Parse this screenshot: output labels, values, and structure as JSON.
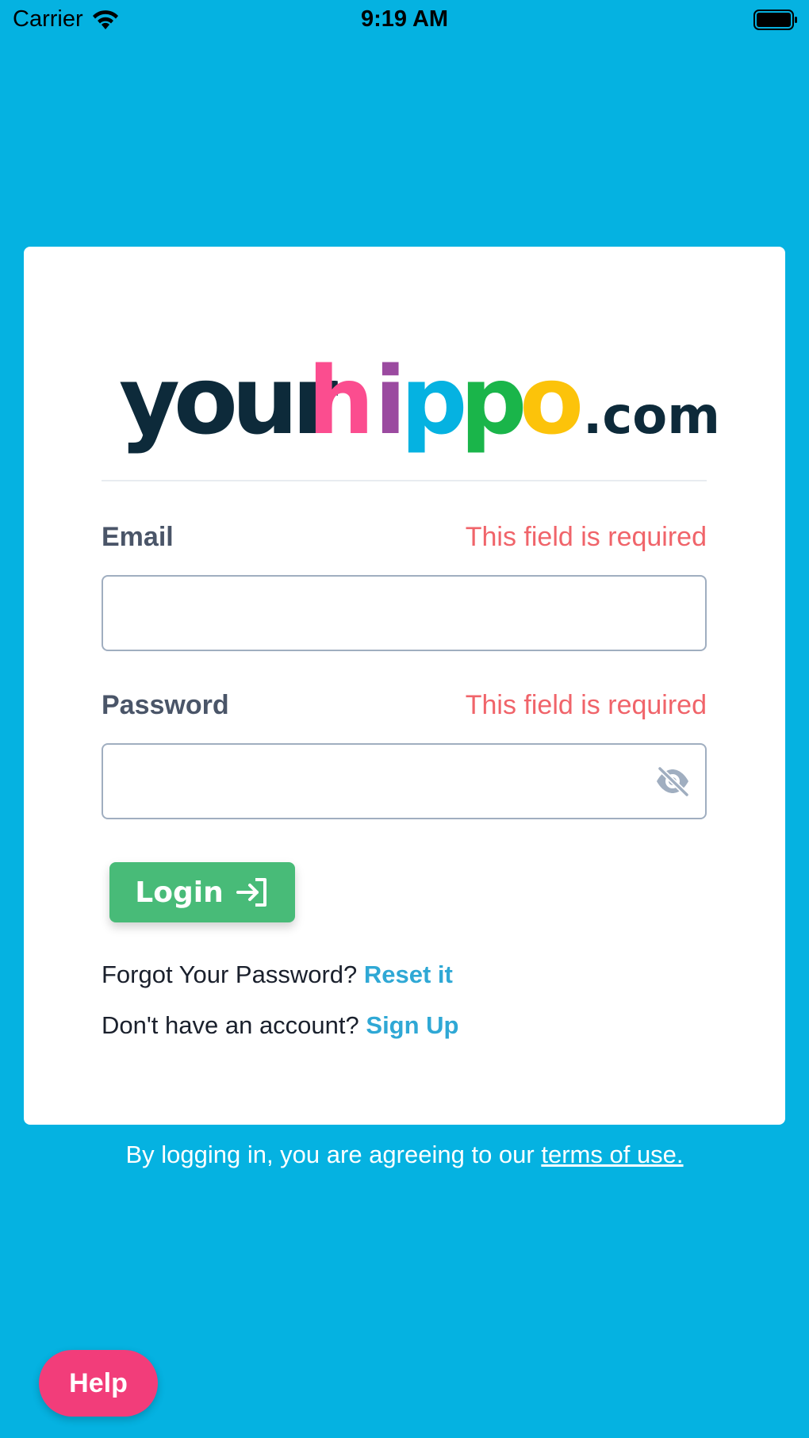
{
  "status_bar": {
    "carrier": "Carrier",
    "time": "9:19 AM"
  },
  "logo": {
    "parts": [
      "your",
      "h",
      "i",
      "p",
      "p",
      "o",
      ".com"
    ],
    "colors": {
      "your": "#0d2a3a",
      "h": "#fb4d8f",
      "i": "#9b4aa0",
      "p1": "#05b2e1",
      "p2": "#1ab54a",
      "o": "#fcc30a",
      "com": "#0d2a3a"
    }
  },
  "form": {
    "email": {
      "label": "Email",
      "error": "This field is required",
      "value": "",
      "placeholder": ""
    },
    "password": {
      "label": "Password",
      "error": "This field is required",
      "value": "",
      "placeholder": "",
      "toggle_icon": "eye-slash-icon"
    },
    "login_label": "Login",
    "login_icon": "sign-in-icon"
  },
  "links": {
    "forgot_text": "Forgot Your Password?",
    "forgot_link": "Reset it",
    "signup_text": "Don't have an account?",
    "signup_link": "Sign Up"
  },
  "terms": {
    "text": "By logging in, you are agreeing to our",
    "link": "terms of use."
  },
  "help": {
    "label": "Help"
  },
  "colors": {
    "background": "#05b2e1",
    "card": "#ffffff",
    "error": "#f0646a",
    "login_button": "#48bb78",
    "link": "#2fa8d5",
    "help_button": "#f23d7a"
  }
}
